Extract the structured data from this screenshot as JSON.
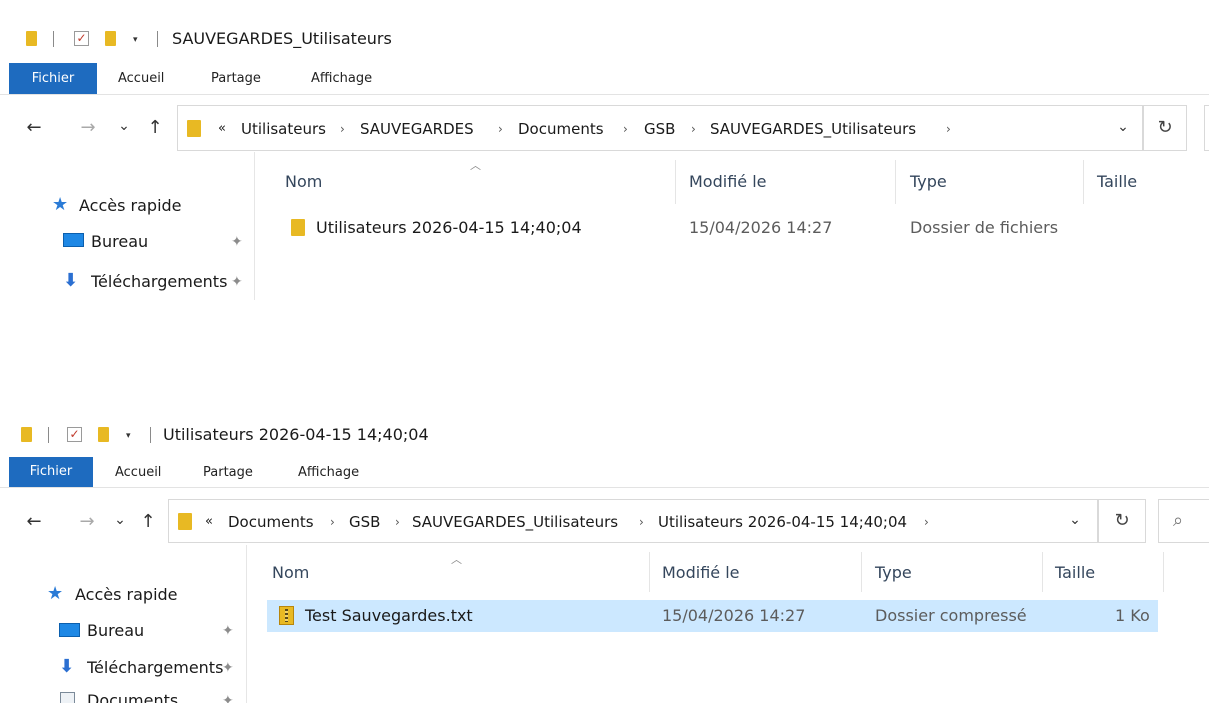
{
  "top_window": {
    "title": "SAUVEGARDES_Utilisateurs",
    "tabs": [
      "Fichier",
      "Accueil",
      "Partage",
      "Affichage"
    ],
    "breadcrumb_overflow": "«",
    "breadcrumb": [
      "Utilisateurs",
      "SAUVEGARDES",
      "Documents",
      "GSB",
      "SAUVEGARDES_Utilisateurs"
    ],
    "sidebar": [
      "Accès rapide",
      "Bureau",
      "Téléchargements"
    ],
    "columns": [
      "Nom",
      "Modifié le",
      "Type",
      "Taille"
    ],
    "rows": [
      {
        "name": "Utilisateurs 2026-04-15 14;40;04",
        "modified": "15/04/2026 14:27",
        "type": "Dossier de fichiers",
        "size": ""
      }
    ]
  },
  "bottom_window": {
    "title": "Utilisateurs 2026-04-15 14;40;04",
    "tabs": [
      "Fichier",
      "Accueil",
      "Partage",
      "Affichage"
    ],
    "breadcrumb_overflow": "«",
    "breadcrumb": [
      "Documents",
      "GSB",
      "SAUVEGARDES_Utilisateurs",
      "Utilisateurs 2026-04-15 14;40;04"
    ],
    "sidebar": [
      "Accès rapide",
      "Bureau",
      "Téléchargements",
      "Documents"
    ],
    "columns": [
      "Nom",
      "Modifié le",
      "Type",
      "Taille"
    ],
    "rows": [
      {
        "name": "Test Sauvegardes.txt",
        "modified": "15/04/2026 14:27",
        "type": "Dossier compressé",
        "size": "1 Ko",
        "selected": true
      }
    ]
  },
  "icons": {
    "back": "←",
    "forward": "→",
    "recent": "⌄",
    "up": "↑",
    "refresh": "↻",
    "search": "⌕",
    "pin": "✦",
    "star": "★",
    "download": "⬇",
    "sort": "︿",
    "dropdown": "▾",
    "check": "✓",
    "chevron": "›"
  },
  "colors": {
    "accent": "#1e6bbf",
    "selection": "#cce8ff",
    "folder": "#e8b923"
  }
}
